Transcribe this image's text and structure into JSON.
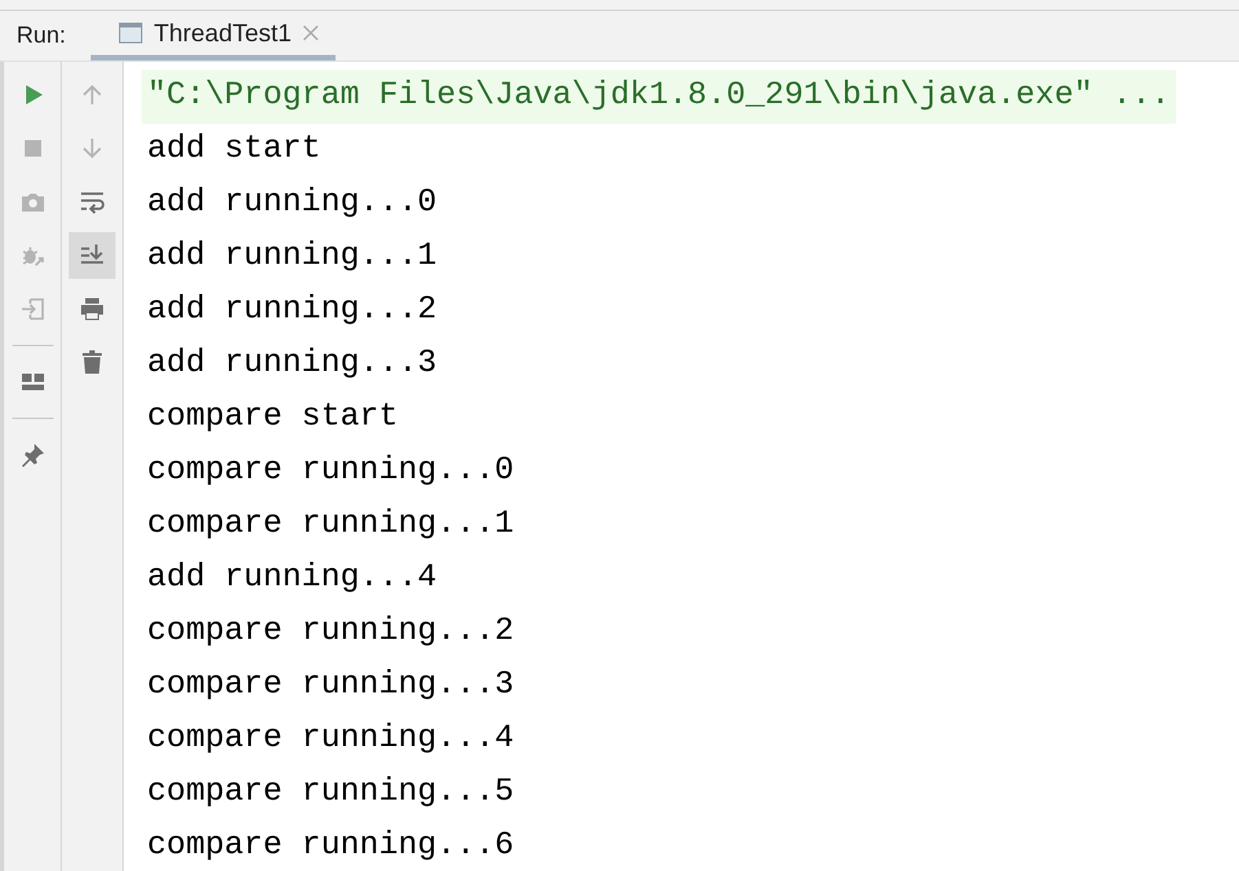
{
  "run_panel": {
    "label": "Run:",
    "tabs": [
      {
        "title": "ThreadTest1",
        "selected": true,
        "closable": true
      }
    ]
  },
  "left_toolbar": [
    {
      "kind": "run",
      "disabled": false
    },
    {
      "kind": "stop",
      "disabled": true
    },
    {
      "kind": "camera",
      "disabled": true
    },
    {
      "kind": "debug",
      "disabled": true
    },
    {
      "kind": "exit",
      "disabled": true
    },
    {
      "kind": "separator"
    },
    {
      "kind": "layout",
      "disabled": false
    },
    {
      "kind": "separator"
    },
    {
      "kind": "pin",
      "disabled": false
    }
  ],
  "console_toolbar": [
    {
      "kind": "up",
      "disabled": true,
      "selected": false
    },
    {
      "kind": "down",
      "disabled": true,
      "selected": false
    },
    {
      "kind": "wrap",
      "disabled": false,
      "selected": false
    },
    {
      "kind": "scroll-end",
      "disabled": false,
      "selected": true
    },
    {
      "kind": "print",
      "disabled": false,
      "selected": false
    },
    {
      "kind": "trash",
      "disabled": false,
      "selected": false
    }
  ],
  "console": [
    {
      "kind": "command",
      "text": "\"C:\\Program Files\\Java\\jdk1.8.0_291\\bin\\java.exe\" ..."
    },
    {
      "kind": "output",
      "text": "add start"
    },
    {
      "kind": "output",
      "text": "add running...0"
    },
    {
      "kind": "output",
      "text": "add running...1"
    },
    {
      "kind": "output",
      "text": "add running...2"
    },
    {
      "kind": "output",
      "text": "add running...3"
    },
    {
      "kind": "output",
      "text": "compare start"
    },
    {
      "kind": "output",
      "text": "compare running...0"
    },
    {
      "kind": "output",
      "text": "compare running...1"
    },
    {
      "kind": "output",
      "text": "add running...4"
    },
    {
      "kind": "output",
      "text": "compare running...2"
    },
    {
      "kind": "output",
      "text": "compare running...3"
    },
    {
      "kind": "output",
      "text": "compare running...4"
    },
    {
      "kind": "output",
      "text": "compare running...5"
    },
    {
      "kind": "output",
      "text": "compare running...6"
    }
  ]
}
